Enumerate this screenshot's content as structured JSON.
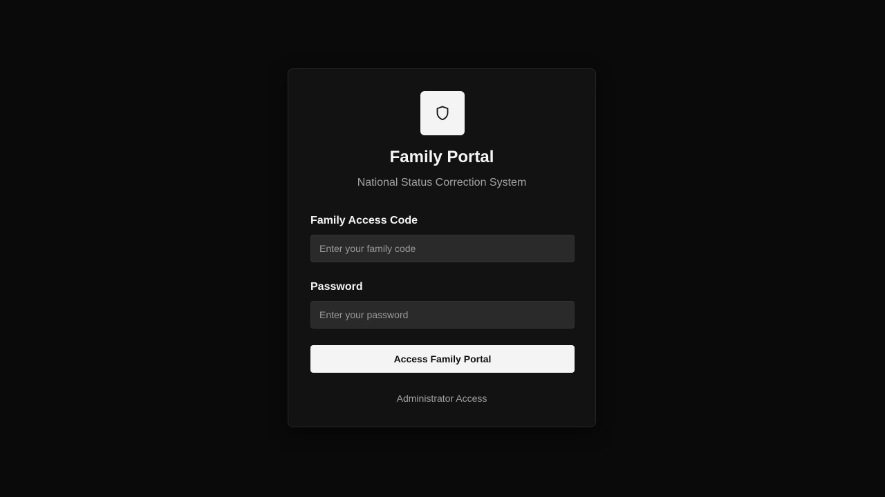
{
  "header": {
    "logo_icon": "shield-icon",
    "title": "Family Portal",
    "subtitle": "National Status Correction System"
  },
  "form": {
    "family_code": {
      "label": "Family Access Code",
      "placeholder": "Enter your family code",
      "value": ""
    },
    "password": {
      "label": "Password",
      "placeholder": "Enter your password",
      "value": ""
    },
    "submit_label": "Access Family Portal"
  },
  "footer": {
    "admin_link": "Administrator Access"
  },
  "colors": {
    "background": "#0a0a0a",
    "card": "#121212",
    "input": "#2a2a2a",
    "button": "#f4f4f4",
    "text_muted": "#a3a3a3"
  }
}
